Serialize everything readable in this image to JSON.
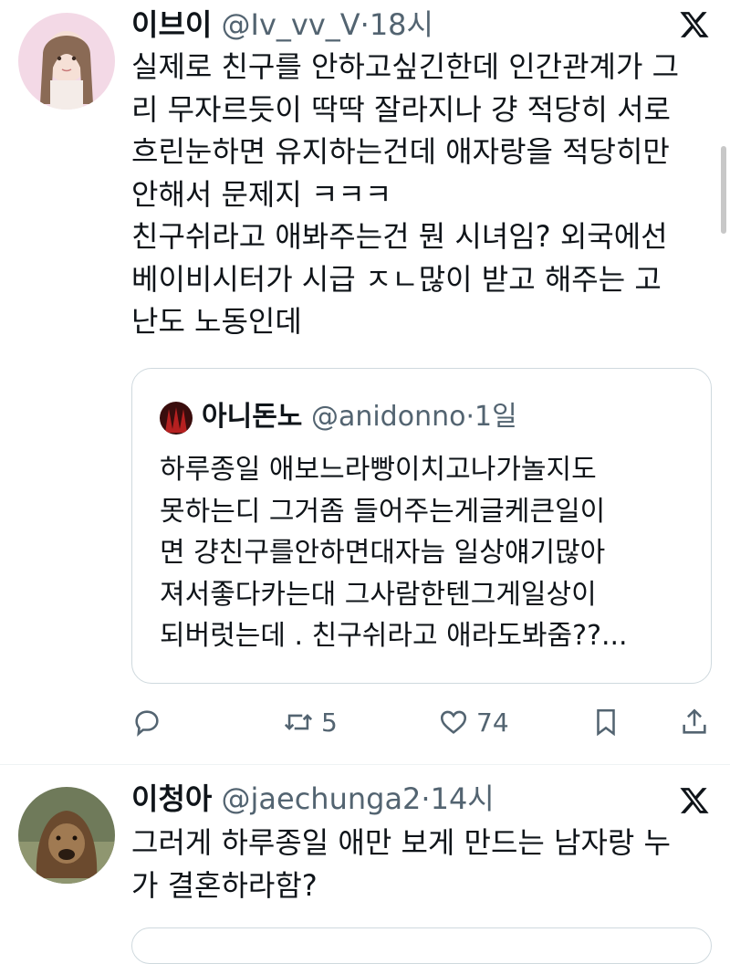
{
  "post1": {
    "name": "이브이",
    "handle": "@Iv_vv_V",
    "sep": "·",
    "time": "18시",
    "text": "실제로 친구를 안하고싶긴한데 인간관계가 그\n리 무자르듯이 딱딱 잘라지나 걍 적당히 서로\n흐린눈하면 유지하는건데 애자랑을 적당히만\n안해서 문제지 ㅋㅋㅋ\n친구쉬라고 애봐주는건 뭔 시녀임? 외국에선\n베이비시터가 시급 ㅈㄴ많이 받고 해주는 고\n난도 노동인데",
    "quote": {
      "name": "아니돈노",
      "handle": "@anidonno",
      "sep": "·",
      "time": "1일",
      "text": "하루종일 애보느라빵이치고나가놀지도\n못하는디 그거좀 들어주는게글케큰일이\n면 걍친구를안하면대자늠 일상얘기많아\n져서좋다카는대 그사람한텐그게일상이\n되버럿는데 . 친구쉬라고 애라도봐줌??..."
    },
    "actions": {
      "reply_icon": "reply-icon",
      "retweets": "5",
      "likes": "74",
      "bookmark_icon": "bookmark-icon",
      "share_icon": "share-icon"
    }
  },
  "post2": {
    "name": "이청아",
    "handle": "@jaechunga2",
    "sep": "·",
    "time": "14시",
    "text": "그러게 하루종일 애만 보게 만드는 남자랑 누\n가 결혼하라함?"
  },
  "colors": {
    "text": "#0f1419",
    "muted": "#536471",
    "border": "#cfd9de"
  }
}
